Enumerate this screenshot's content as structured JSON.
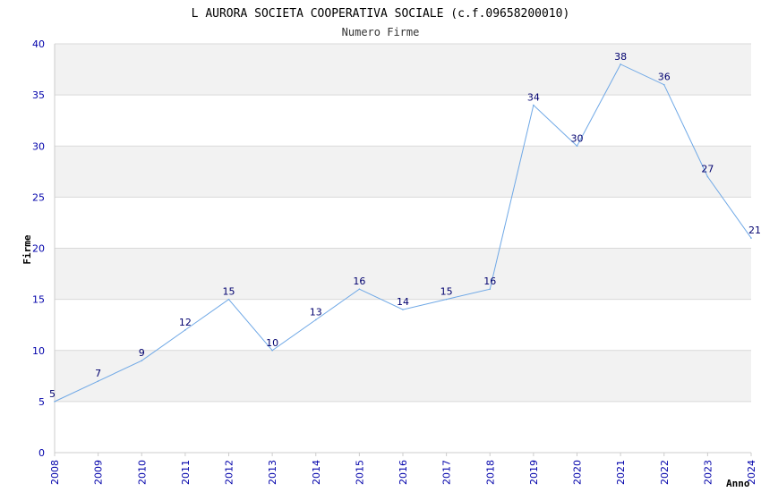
{
  "chart_data": {
    "type": "line",
    "title": "L AURORA SOCIETA COOPERATIVA SOCIALE (c.f.09658200010)",
    "subtitle": "Numero Firme",
    "xlabel": "Anno",
    "ylabel": "Firme",
    "x": [
      "2008",
      "2009",
      "2010",
      "2011",
      "2012",
      "2013",
      "2014",
      "2015",
      "2016",
      "2017",
      "2018",
      "2019",
      "2020",
      "2021",
      "2022",
      "2023",
      "2024"
    ],
    "values": [
      5,
      7,
      9,
      12,
      15,
      10,
      13,
      16,
      14,
      15,
      16,
      34,
      30,
      38,
      36,
      27,
      21
    ],
    "ylim": [
      0,
      40
    ],
    "yticks": [
      0,
      5,
      10,
      15,
      20,
      25,
      30,
      35,
      40
    ],
    "grid": "horizontal alternating bands",
    "colors": {
      "line": "#6fa8e6",
      "band": "#f2f2f2",
      "grid": "#d9d9d9",
      "tick_labels": "#0000aa",
      "data_labels": "#00006e"
    }
  }
}
